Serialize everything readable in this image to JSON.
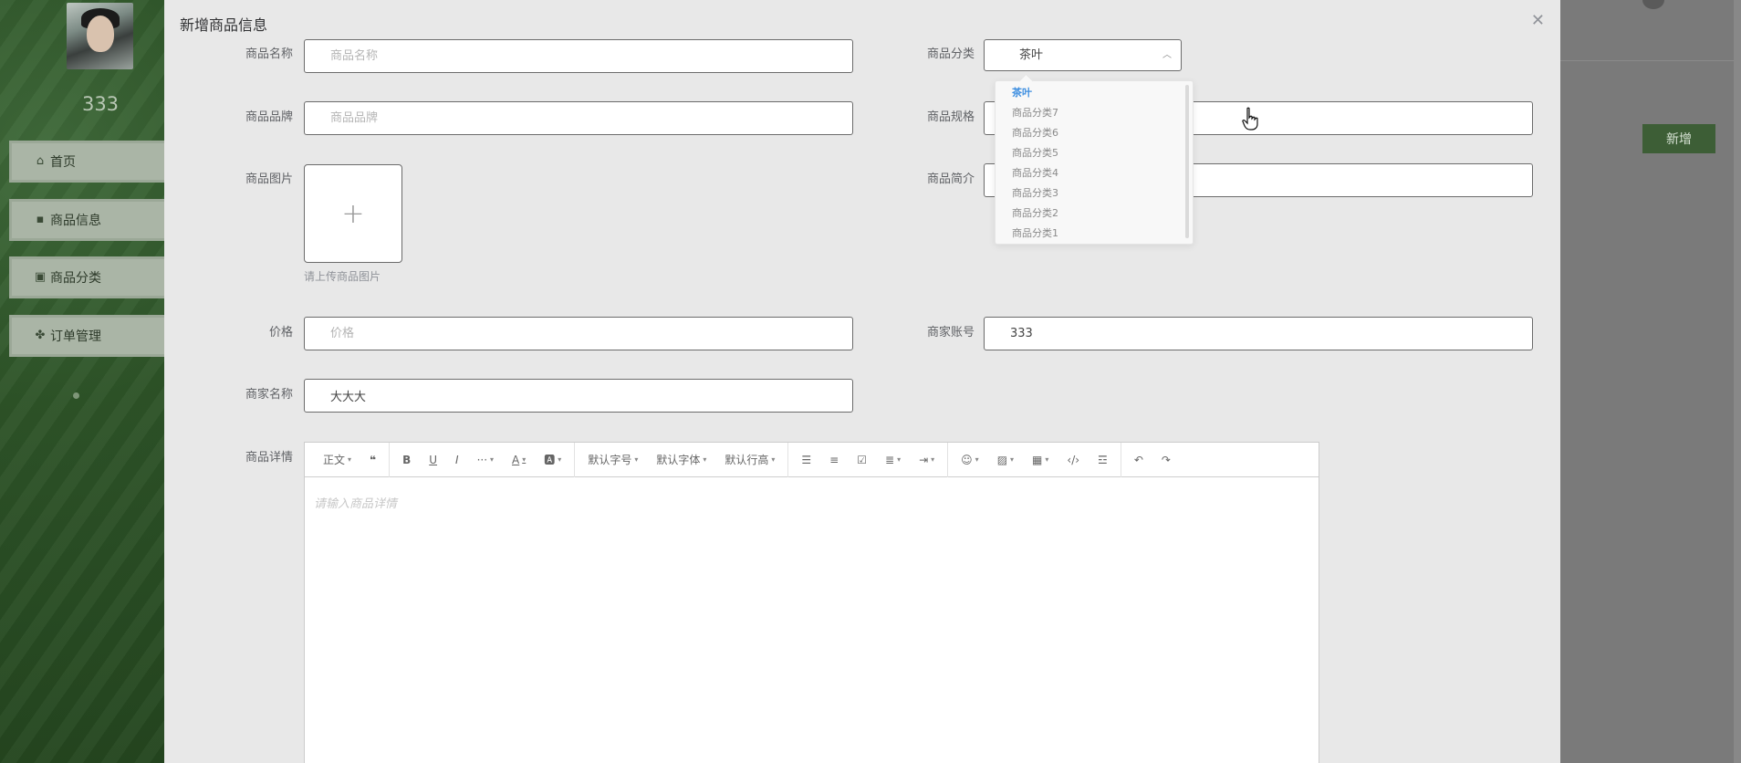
{
  "sidebar": {
    "username": "333",
    "items": [
      {
        "label": "首页",
        "icon": "home-icon"
      },
      {
        "label": "商品信息",
        "icon": "goods-icon"
      },
      {
        "label": "商品分类",
        "icon": "category-icon"
      },
      {
        "label": "订单管理",
        "icon": "order-icon"
      }
    ]
  },
  "background": {
    "new_button": "新增"
  },
  "dialog": {
    "title": "新增商品信息",
    "fields": {
      "name": {
        "label": "商品名称",
        "placeholder": "商品名称",
        "value": ""
      },
      "category": {
        "label": "商品分类",
        "value": "茶叶"
      },
      "brand": {
        "label": "商品品牌",
        "placeholder": "商品品牌",
        "value": ""
      },
      "spec": {
        "label": "商品规格",
        "value": ""
      },
      "image": {
        "label": "商品图片",
        "tip": "请上传商品图片"
      },
      "intro": {
        "label": "商品简介",
        "value": ""
      },
      "price": {
        "label": "价格",
        "placeholder": "价格",
        "value": ""
      },
      "merchant_account": {
        "label": "商家账号",
        "value": "333"
      },
      "merchant_name": {
        "label": "商家名称",
        "value": "大大大"
      },
      "detail": {
        "label": "商品详情",
        "placeholder": "请输入商品详情"
      }
    },
    "category_options": [
      "茶叶",
      "商品分类7",
      "商品分类6",
      "商品分类5",
      "商品分类4",
      "商品分类3",
      "商品分类2",
      "商品分类1"
    ]
  },
  "editor_toolbar": {
    "paragraph": "正文",
    "font_size": "默认字号",
    "font_family": "默认字体",
    "line_height": "默认行高"
  },
  "colors": {
    "accent": "#3d5e36",
    "active_option": "#3f8fe0"
  }
}
